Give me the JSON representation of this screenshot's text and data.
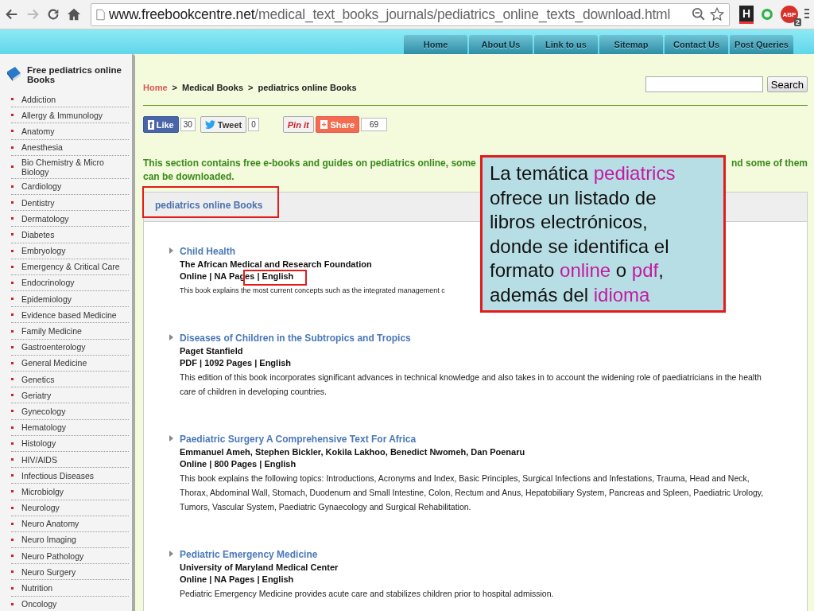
{
  "browser": {
    "url_host": "www.freebookcentre.net",
    "url_path": "/medical_text_books_journals/pediatrics_online_texts_download.html",
    "forward_disabled": true,
    "extensions": [
      {
        "kind": "letter",
        "label": "H"
      },
      {
        "kind": "ring"
      },
      {
        "kind": "abp",
        "label": "ABP",
        "badge": "2"
      }
    ]
  },
  "nav": [
    "Home",
    "About Us",
    "Link to us",
    "Sitemap",
    "Contact Us",
    "Post Queries"
  ],
  "sidebar": {
    "title": "Free pediatrics online Books",
    "items": [
      "Addiction",
      "Allergy & Immunology",
      "Anatomy",
      "Anesthesia",
      "Bio Chemistry & Micro Biology",
      "Cardiology",
      "Dentistry",
      "Dermatology",
      "Diabetes",
      "Embryology",
      "Emergency & Critical Care",
      "Endocrinology",
      "Epidemiology",
      "Evidence based Medicine",
      "Family Medicine",
      "Gastroenterology",
      "General Medicine",
      "Genetics",
      "Geriatry",
      "Gynecology",
      "Hematology",
      "Histology",
      "HIV/AIDS",
      "Infectious Diseases",
      "Microbiolgy",
      "Neurology",
      "Neuro Anatomy",
      "Neuro Imaging",
      "Neuro Pathology",
      "Neuro Surgery",
      "Nutrition",
      "Oncology"
    ]
  },
  "breadcrumb": [
    {
      "label": "Home",
      "kind": "link"
    },
    {
      "label": ">",
      "kind": "sep"
    },
    {
      "label": "Medical Books",
      "kind": "text"
    },
    {
      "label": ">",
      "kind": "sep"
    },
    {
      "label": "pediatrics online Books",
      "kind": "text"
    }
  ],
  "search": {
    "button": "Search"
  },
  "social": [
    {
      "kind": "like",
      "icon": "f",
      "label": "Like",
      "count": "30"
    },
    {
      "kind": "tweet",
      "label": "Tweet",
      "count": "0"
    },
    {
      "kind": "pin",
      "label": "Pin it"
    },
    {
      "kind": "share",
      "icon": "+",
      "label": "Share",
      "count": "69"
    }
  ],
  "intro": {
    "line1_start": "This section contains free e-books and guides on pediatrics online, some",
    "line1_end": "nd some of them",
    "line2": "can be downloaded."
  },
  "tab": {
    "label": "pediatrics online Books"
  },
  "books": [
    {
      "title": "Child Health",
      "author": "The African Medical and Research Foundation",
      "meta": "Online | NA Pages | English",
      "description": "This book explains the most current concepts such as the integrated management c"
    },
    {
      "title": "Diseases of Children in the Subtropics and Tropics",
      "author": "Paget Stanfield",
      "meta": "PDF | 1092 Pages | English",
      "description": "This edition of this book incorporates significant advances in technical knowledge and also takes in to account the widening role of paediatricians in the health care of children in developing countries."
    },
    {
      "title": "Paediatric Surgery A Comprehensive Text For Africa",
      "author": "Emmanuel Ameh, Stephen Bickler, Kokila Lakhoo, Benedict Nwomeh, Dan Poenaru",
      "meta": "Online | 800 Pages | English",
      "description": "This book explains the following topics: Introductions, Acronyms and Index, Basic Principles, Surgical Infections and Infestations, Trauma, Head and Neck, Thorax, Abdominal Wall, Stomach, Duodenum and Small Intestine, Colon, Rectum and Anus, Hepatobiliary System, Pancreas and Spleen, Paediatric Urology, Tumors, Vascular System, Paediatric Gynaecology and Surgical Rehabilitation."
    },
    {
      "title": "Pediatric Emergency Medicine",
      "author": "University of Maryland Medical Center",
      "meta": "Online | NA Pages | English",
      "description": "Pediatric Emergency Medicine provides acute care and stabilizes children prior to hospital admission."
    }
  ],
  "callout": [
    {
      "text": "La temática ",
      "highlight": false
    },
    {
      "text": "pediatrics",
      "highlight": true
    },
    {
      "text": " ofrece un listado de libros electrónicos, donde se identifica el formato ",
      "highlight": false
    },
    {
      "text": "online",
      "highlight": true
    },
    {
      "text": " o ",
      "highlight": false
    },
    {
      "text": "pdf",
      "highlight": true
    },
    {
      "text": ", además del ",
      "highlight": false
    },
    {
      "text": "idioma",
      "highlight": true
    }
  ]
}
